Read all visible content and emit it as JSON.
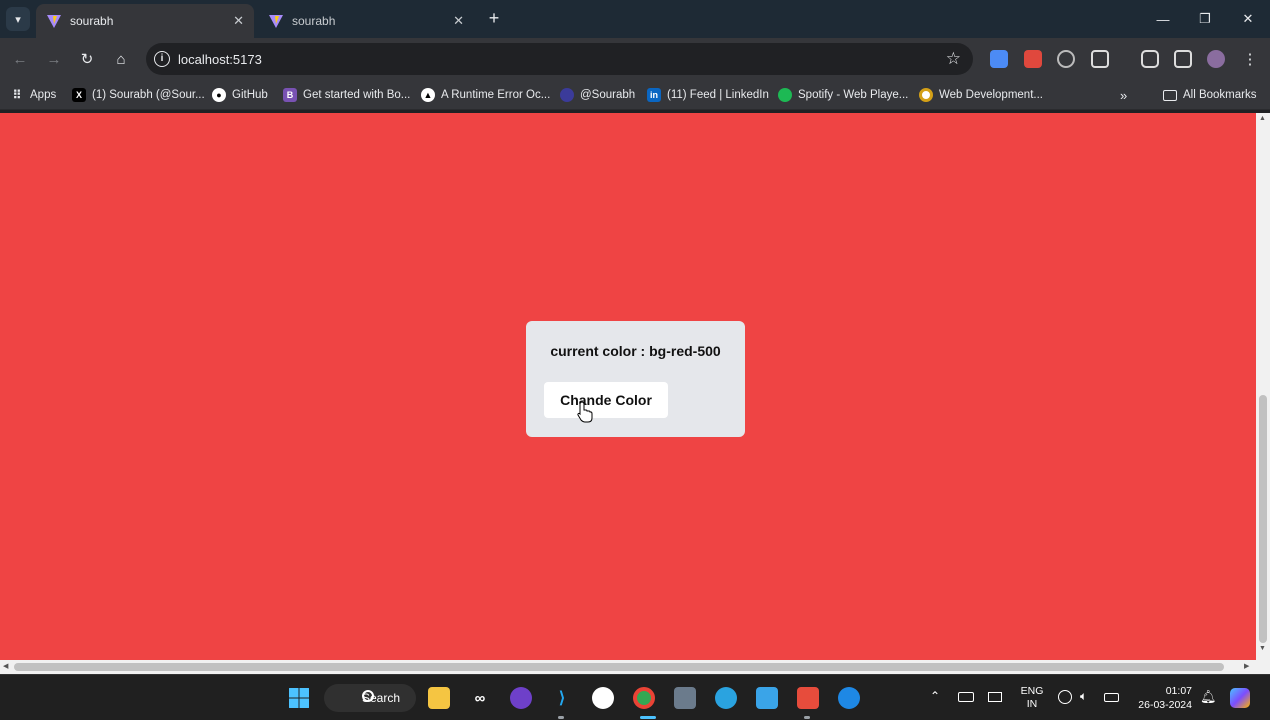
{
  "browser": {
    "tabs": [
      {
        "title": "sourabh",
        "active": true
      },
      {
        "title": "sourabh",
        "active": false
      }
    ],
    "url": "localhost:5173",
    "bookmarks": [
      {
        "label": "Apps",
        "icon": "apps-grid-icon"
      },
      {
        "label": "(1) Sourabh (@Sour...",
        "icon": "x-logo-icon"
      },
      {
        "label": "GitHub",
        "icon": "github-icon"
      },
      {
        "label": "Get started with Bo...",
        "icon": "bootstrap-icon"
      },
      {
        "label": "A Runtime Error Oc...",
        "icon": "triangle-icon"
      },
      {
        "label": "@Sourabh",
        "icon": "hashnode-icon"
      },
      {
        "label": "(11) Feed | LinkedIn",
        "icon": "linkedin-icon"
      },
      {
        "label": "Spotify - Web Playe...",
        "icon": "spotify-icon"
      },
      {
        "label": "Web Development...",
        "icon": "chrome-favicon-icon"
      }
    ],
    "all_bookmarks_label": "All Bookmarks"
  },
  "page": {
    "background_color": "#ef4444",
    "current_color_label": "current color : bg-red-500",
    "button_label": "Chande Color"
  },
  "taskbar": {
    "search_label": "Search",
    "language": "ENG",
    "region": "IN",
    "time": "01:07",
    "date": "26-03-2024"
  }
}
